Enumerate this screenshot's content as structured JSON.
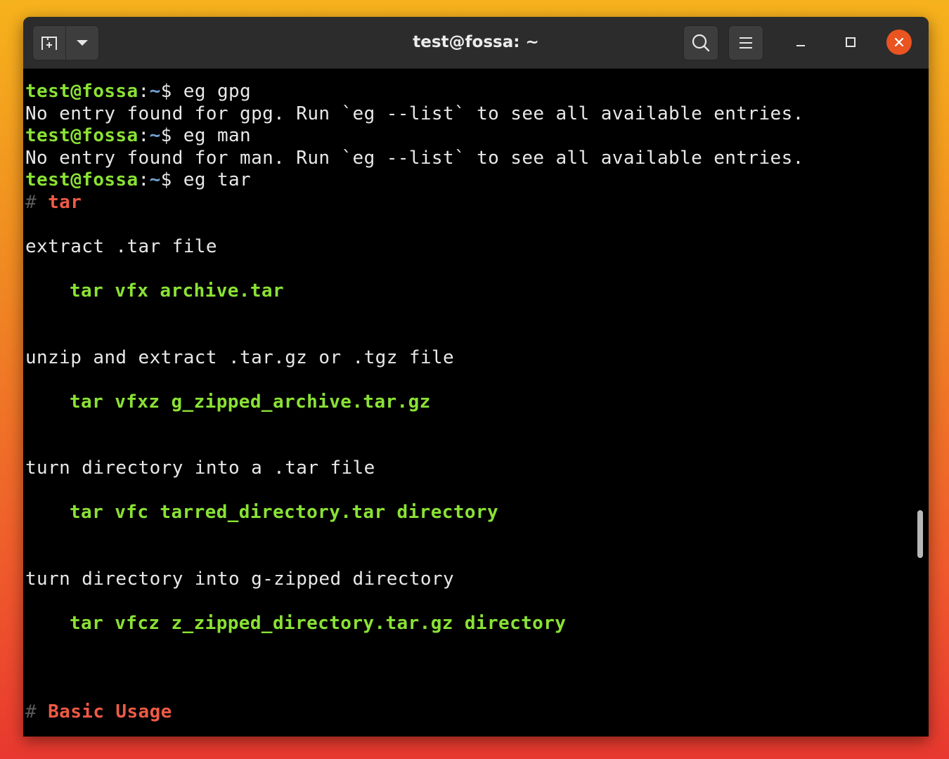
{
  "window": {
    "title": "test@fossa: ~"
  },
  "titlebar": {
    "new_tab_icon": "new-tab-icon",
    "dropdown_icon": "chevron-down-icon",
    "search_icon": "search-icon",
    "menu_icon": "hamburger-menu-icon",
    "minimize_icon": "minimize-icon",
    "maximize_icon": "maximize-icon",
    "close_icon": "close-icon",
    "close_color": "#e95420"
  },
  "terminal": {
    "prompt_user": "test@fossa",
    "prompt_colon": ":",
    "prompt_path": "~",
    "prompt_symbol": "$ ",
    "commands": [
      "eg gpg",
      "eg man",
      "eg tar"
    ],
    "errors": [
      "No entry found for gpg. Run `eg --list` to see all available entries.",
      "No entry found for man. Run `eg --list` to see all available entries."
    ],
    "heading_hash": "# ",
    "heading_tar": "tar",
    "heading_basic": "Basic Usage",
    "examples": [
      {
        "desc": "extract .tar file",
        "cmd": "tar vfx archive.tar"
      },
      {
        "desc": "unzip and extract .tar.gz or .tgz file",
        "cmd": "tar vfxz g_zipped_archive.tar.gz"
      },
      {
        "desc": "turn directory into a .tar file",
        "cmd": "tar vfc tarred_directory.tar directory"
      },
      {
        "desc": "turn directory into g-zipped directory",
        "cmd": "tar vfcz z_zipped_directory.tar.gz directory"
      }
    ],
    "colors": {
      "prompt": "#8ae234",
      "path": "#729fcf",
      "heading": "#ef5a45",
      "text": "#e8e8e8"
    }
  }
}
